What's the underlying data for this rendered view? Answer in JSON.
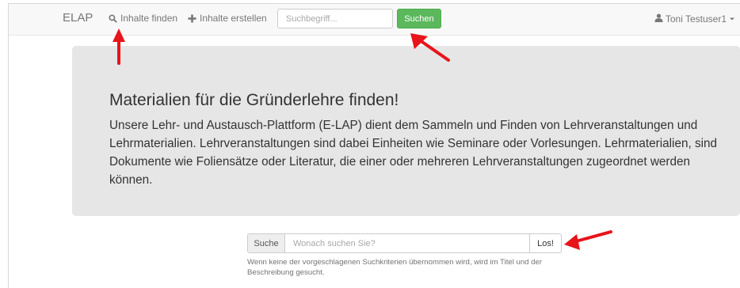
{
  "navbar": {
    "brand": "ELAP",
    "find_link": {
      "label": "Inhalte finden",
      "icon": "search-icon"
    },
    "create_link": {
      "label": "Inhalte erstellen",
      "icon": "plus-icon"
    },
    "search": {
      "placeholder": "Suchbegriff...",
      "value": ""
    },
    "search_button": "Suchen",
    "user": {
      "name": "Toni Testuser1",
      "icon": "user-icon",
      "caret": "chevron-down-icon"
    }
  },
  "jumbotron": {
    "title": "Materialien für die Gründerlehre finden!",
    "text": "Unsere Lehr- und Austausch-Plattform (E-LAP) dient dem Sammeln und Finden von Lehrveranstaltungen und Lehrmaterialien. Lehrveranstaltungen sind dabei Einheiten wie Seminare oder Vorlesungen. Lehrmaterialien, sind Dokumente wie Foliensätze oder Literatur, die einer oder mehreren Lehrveranstaltungen zugeordnet werden können."
  },
  "main_search": {
    "addon_label": "Suche",
    "placeholder": "Wonach suchen Sie?",
    "value": "",
    "button": "Los!",
    "help": "Wenn keine der vorgeschlagenen Suchkriterien übernommen wird, wird im Titel und der Beschreibung gesucht."
  },
  "colors": {
    "navbar_bg": "#f8f8f8",
    "primary_green": "#5cb85c",
    "jumbotron_bg": "#e6e6e6",
    "annotation_arrow": "#e8141b"
  }
}
